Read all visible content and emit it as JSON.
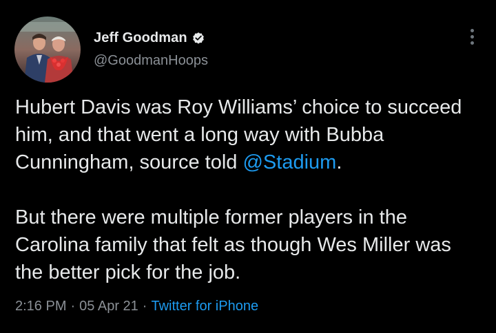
{
  "author": {
    "display_name": "Jeff Goodman",
    "handle": "@GoodmanHoops",
    "verified": true
  },
  "tweet": {
    "paragraphs": [
      {
        "before": "Hubert Davis was Roy Williams’ choice to succeed him, and that went a long way with Bubba Cunningham, source told ",
        "mention": "@Stadium",
        "after": "."
      },
      {
        "text": "But there were multiple former players in the Carolina family that felt as though Wes Miller was the better pick for the job."
      }
    ]
  },
  "meta": {
    "time": "2:16 PM",
    "separator": "·",
    "date": "05 Apr 21",
    "source": "Twitter for iPhone"
  },
  "icons": {
    "verified": "verified-badge-icon",
    "more": "more-options-icon"
  },
  "colors": {
    "background": "#000000",
    "text": "#e7e9ea",
    "secondary": "#8b9096",
    "link": "#1d9bf0"
  }
}
